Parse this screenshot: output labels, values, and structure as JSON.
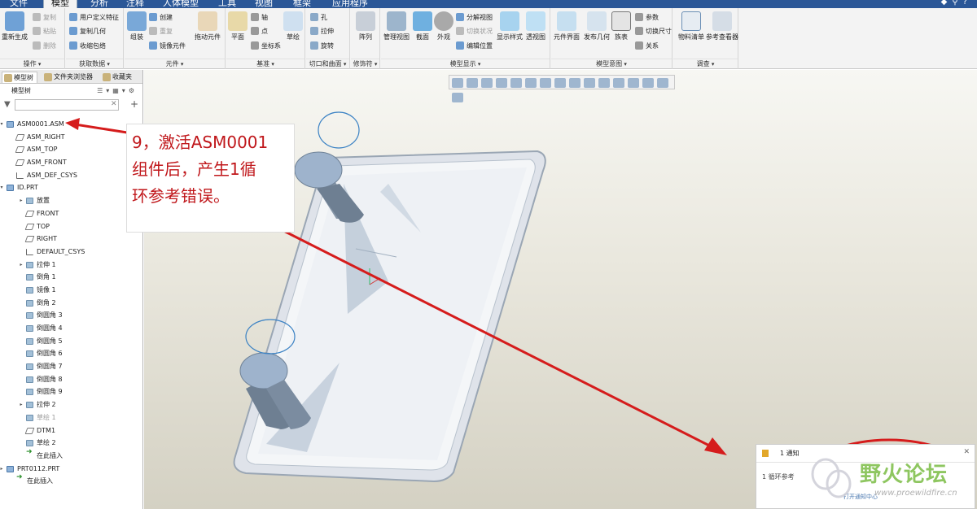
{
  "menu": {
    "tabs": [
      "文件",
      "模型",
      "分析",
      "注释",
      "人体模型",
      "工具",
      "视图",
      "框架",
      "应用程序"
    ],
    "active": "模型"
  },
  "ribbon": {
    "groups": [
      {
        "label": "操作",
        "buttons": [
          "重新生成",
          "复制",
          "粘贴",
          "删除"
        ]
      },
      {
        "label": "获取数据",
        "buttons": [
          "用户定义特征",
          "复制几何",
          "收缩包络"
        ]
      },
      {
        "label": "元件",
        "buttons": [
          "组装",
          "创建",
          "重复",
          "镜像元件",
          "拖动元件"
        ]
      },
      {
        "label": "基准",
        "buttons": [
          "平面",
          "轴",
          "点",
          "坐标系",
          "草绘"
        ]
      },
      {
        "label": "切口和曲面",
        "buttons": [
          "孔",
          "拉伸",
          "旋转"
        ]
      },
      {
        "label": "修饰符",
        "buttons": [
          "阵列"
        ]
      },
      {
        "label": "模型显示",
        "buttons": [
          "管理视图",
          "截面",
          "外观",
          "分解视图",
          "切换状况",
          "编辑位置",
          "显示样式",
          "透视图"
        ]
      },
      {
        "label": "模型意图",
        "buttons": [
          "元件界面",
          "发布几何",
          "族表",
          "参数",
          "切换尺寸",
          "关系"
        ]
      },
      {
        "label": "调查",
        "buttons": [
          "物料清单",
          "参考查看器"
        ]
      }
    ]
  },
  "navigator": {
    "tabs": [
      "模型树",
      "文件夹浏览器",
      "收藏夹"
    ],
    "tree_header": "模型树",
    "filter_placeholder": ""
  },
  "tree": [
    {
      "label": "ASM0001.ASM",
      "icon": "assembly-icon",
      "level": 0,
      "expand": "open"
    },
    {
      "label": "ASM_RIGHT",
      "icon": "datum-plane-icon",
      "level": 1
    },
    {
      "label": "ASM_TOP",
      "icon": "datum-plane-icon",
      "level": 1
    },
    {
      "label": "ASM_FRONT",
      "icon": "datum-plane-icon",
      "level": 1
    },
    {
      "label": "ASM_DEF_CSYS",
      "icon": "csys-icon",
      "level": 1
    },
    {
      "label": "ID.PRT",
      "icon": "part-icon",
      "level": 0,
      "expand": "open"
    },
    {
      "label": "放置",
      "icon": "placement-icon",
      "level": 2,
      "expand": "closed"
    },
    {
      "label": "FRONT",
      "icon": "datum-plane-icon",
      "level": 2
    },
    {
      "label": "TOP",
      "icon": "datum-plane-icon",
      "level": 2
    },
    {
      "label": "RIGHT",
      "icon": "datum-plane-icon",
      "level": 2
    },
    {
      "label": "DEFAULT_CSYS",
      "icon": "csys-icon",
      "level": 2
    },
    {
      "label": "拉伸 1",
      "icon": "extrude-icon",
      "level": 2,
      "expand": "closed"
    },
    {
      "label": "倒角 1",
      "icon": "chamfer-icon",
      "level": 2
    },
    {
      "label": "镜像 1",
      "icon": "mirror-icon",
      "level": 2
    },
    {
      "label": "倒角 2",
      "icon": "chamfer-icon",
      "level": 2
    },
    {
      "label": "倒圆角 3",
      "icon": "round-icon",
      "level": 2
    },
    {
      "label": "倒圆角 4",
      "icon": "round-icon",
      "level": 2
    },
    {
      "label": "倒圆角 5",
      "icon": "round-icon",
      "level": 2
    },
    {
      "label": "倒圆角 6",
      "icon": "round-icon",
      "level": 2
    },
    {
      "label": "倒圆角 7",
      "icon": "round-icon",
      "level": 2
    },
    {
      "label": "倒圆角 8",
      "icon": "round-icon",
      "level": 2
    },
    {
      "label": "倒圆角 9",
      "icon": "round-icon",
      "level": 2
    },
    {
      "label": "拉伸 2",
      "icon": "extrude-icon",
      "level": 2,
      "expand": "closed"
    },
    {
      "label": "草绘 1",
      "icon": "sketch-icon",
      "level": 2,
      "dim": true
    },
    {
      "label": "DTM1",
      "icon": "datum-plane-icon",
      "level": 2
    },
    {
      "label": "草绘 2",
      "icon": "sketch-icon",
      "level": 2
    },
    {
      "label": "在此插入",
      "icon": "insert-here-icon",
      "level": 2
    },
    {
      "label": "PRT0112.PRT",
      "icon": "part-icon",
      "level": 0,
      "expand": "closed"
    },
    {
      "label": "在此插入",
      "icon": "insert-here-icon",
      "level": 1
    }
  ],
  "annotation": {
    "lines": [
      "9，激活ASM0001",
      "组件后，产生1循",
      "环参考错误。"
    ],
    "color": "#c0171b"
  },
  "notification": {
    "title": "1 通知",
    "message": "1 循环参考",
    "link": "打开通知中心"
  },
  "watermark": {
    "text": "野火论坛",
    "url": "www.proewildfire.cn"
  }
}
